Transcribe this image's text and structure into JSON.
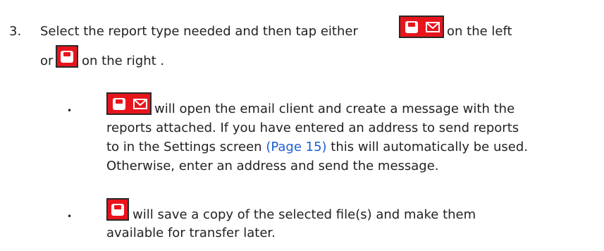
{
  "step": {
    "number": "3.",
    "text_before_icon": "Select the report type needed and then tap either",
    "text_after_icon": "on the left",
    "line2_or": "or",
    "line2_after_icon": "on the right ."
  },
  "bullets": [
    {
      "marker": "•",
      "line1_after_icon": "will open the email client and create a message with the",
      "line2": "reports attached. If you have entered an address to send reports",
      "line3_before_link": "to in the Settings screen",
      "link_text": "(Page 15)",
      "line3_after_link": "this will automatically be used.",
      "line4": "Otherwise, enter an address and send the message."
    },
    {
      "marker": "•",
      "line1_after_icon": "will save a copy of the selected file(s) and make them",
      "line2": "available for transfer later."
    }
  ],
  "icons": {
    "save_and_email": "save-email-icon",
    "save": "save-icon",
    "accent_color": "#e8141c"
  }
}
